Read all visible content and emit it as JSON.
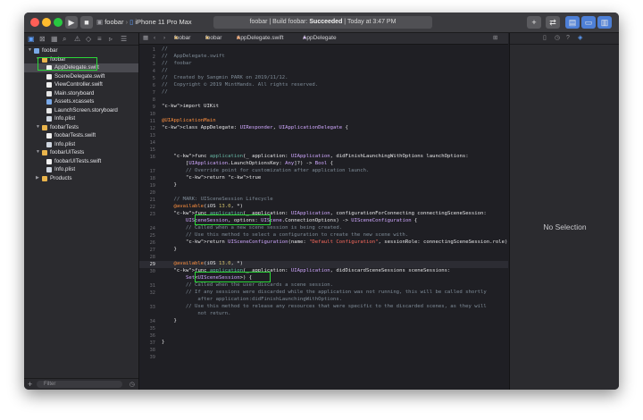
{
  "toolbar": {
    "scheme": "foobar",
    "device": "iPhone 11 Pro Max",
    "activity_prefix": "foobar | Build foobar: ",
    "activity_status": "Succeeded",
    "activity_time": " | Today at 3:47 PM",
    "plus_label": "+"
  },
  "navigator": {
    "items": [
      {
        "label": "foobar",
        "indent": 0,
        "kind": "project",
        "open": true
      },
      {
        "label": "foobar",
        "indent": 1,
        "kind": "folder",
        "open": true
      },
      {
        "label": "AppDelegate.swift",
        "indent": 2,
        "kind": "swift",
        "selected": true
      },
      {
        "label": "SceneDelegate.swift",
        "indent": 2,
        "kind": "swift"
      },
      {
        "label": "ViewController.swift",
        "indent": 2,
        "kind": "swift"
      },
      {
        "label": "Main.storyboard",
        "indent": 2,
        "kind": "storyboard"
      },
      {
        "label": "Assets.xcassets",
        "indent": 2,
        "kind": "assets"
      },
      {
        "label": "LaunchScreen.storyboard",
        "indent": 2,
        "kind": "storyboard"
      },
      {
        "label": "Info.plist",
        "indent": 2,
        "kind": "plist"
      },
      {
        "label": "foobarTests",
        "indent": 1,
        "kind": "folder",
        "open": true
      },
      {
        "label": "foobarTests.swift",
        "indent": 2,
        "kind": "swift"
      },
      {
        "label": "Info.plist",
        "indent": 2,
        "kind": "plist"
      },
      {
        "label": "foobarUITests",
        "indent": 1,
        "kind": "folder",
        "open": true
      },
      {
        "label": "foobarUITests.swift",
        "indent": 2,
        "kind": "swift"
      },
      {
        "label": "Info.plist",
        "indent": 2,
        "kind": "plist"
      },
      {
        "label": "Products",
        "indent": 1,
        "kind": "folder",
        "open": false
      }
    ],
    "filter_placeholder": "Filter"
  },
  "jumpbar": {
    "crumbs": [
      "foobar",
      "foobar",
      "AppDelegate.swift",
      "AppDelegate"
    ]
  },
  "editor": {
    "current_line": "29",
    "lines": [
      {
        "n": "1",
        "t": "//",
        "c": "com"
      },
      {
        "n": "2",
        "t": "//  AppDelegate.swift",
        "c": "com"
      },
      {
        "n": "3",
        "t": "//  foobar",
        "c": "com"
      },
      {
        "n": "4",
        "t": "//",
        "c": "com"
      },
      {
        "n": "5",
        "t": "//  Created by Sangmin PARK on 2019/11/12.",
        "c": "com"
      },
      {
        "n": "6",
        "t": "//  Copyright © 2019 MintHands. All rights reserved.",
        "c": "com"
      },
      {
        "n": "7",
        "t": "//",
        "c": "com"
      },
      {
        "n": "8",
        "t": "",
        "c": ""
      },
      {
        "n": "9",
        "t": "import UIKit",
        "c": "import"
      },
      {
        "n": "10",
        "t": "",
        "c": ""
      },
      {
        "n": "11",
        "t": "@UIApplicationMain",
        "c": "attr"
      },
      {
        "n": "12",
        "t": "class AppDelegate: UIResponder, UIApplicationDelegate {",
        "c": "class"
      },
      {
        "n": "13",
        "t": "",
        "c": ""
      },
      {
        "n": "14",
        "t": "",
        "c": ""
      },
      {
        "n": "15",
        "t": "",
        "c": ""
      },
      {
        "n": "16",
        "t": "    func application(_ application: UIApplication, didFinishLaunchingWithOptions launchOptions:",
        "c": "func"
      },
      {
        "n": "",
        "t": "        [UIApplication.LaunchOptionsKey: Any]?) -> Bool {",
        "c": "plain"
      },
      {
        "n": "17",
        "t": "        // Override point for customization after application launch.",
        "c": "com"
      },
      {
        "n": "18",
        "t": "        return true",
        "c": "return"
      },
      {
        "n": "19",
        "t": "    }",
        "c": "plain"
      },
      {
        "n": "20",
        "t": "",
        "c": ""
      },
      {
        "n": "21",
        "t": "    // MARK: UISceneSession Lifecycle",
        "c": "com"
      },
      {
        "n": "22",
        "t": "    @available(iOS 13.0, *)",
        "c": "avail"
      },
      {
        "n": "23",
        "t": "    func application(_ application: UIApplication, configurationForConnecting connectingSceneSession:",
        "c": "func"
      },
      {
        "n": "",
        "t": "        UISceneSession, options: UIScene.ConnectionOptions) -> UISceneConfiguration {",
        "c": "plain"
      },
      {
        "n": "24",
        "t": "        // Called when a new scene session is being created.",
        "c": "com"
      },
      {
        "n": "25",
        "t": "        // Use this method to select a configuration to create the new scene with.",
        "c": "com"
      },
      {
        "n": "26",
        "t": "        return UISceneConfiguration(name: \"Default Configuration\", sessionRole: connectingSceneSession.role)",
        "c": "return2"
      },
      {
        "n": "27",
        "t": "    }",
        "c": "plain"
      },
      {
        "n": "28",
        "t": "",
        "c": ""
      },
      {
        "n": "29",
        "t": "    @available(iOS 13.0, *)",
        "c": "avail"
      },
      {
        "n": "30",
        "t": "    func application(_ application: UIApplication, didDiscardSceneSessions sceneSessions:",
        "c": "func"
      },
      {
        "n": "",
        "t": "        Set<UISceneSession>) {",
        "c": "plain"
      },
      {
        "n": "31",
        "t": "        // Called when the user discards a scene session.",
        "c": "com"
      },
      {
        "n": "32",
        "t": "        // If any sessions were discarded while the application was not running, this will be called shortly",
        "c": "com"
      },
      {
        "n": "",
        "t": "            after application:didFinishLaunchingWithOptions.",
        "c": "com"
      },
      {
        "n": "33",
        "t": "        // Use this method to release any resources that were specific to the discarded scenes, as they will",
        "c": "com"
      },
      {
        "n": "",
        "t": "            not return.",
        "c": "com"
      },
      {
        "n": "34",
        "t": "    }",
        "c": "plain"
      },
      {
        "n": "35",
        "t": "",
        "c": ""
      },
      {
        "n": "36",
        "t": "",
        "c": ""
      },
      {
        "n": "37",
        "t": "}",
        "c": "plain"
      },
      {
        "n": "38",
        "t": "",
        "c": ""
      },
      {
        "n": "39",
        "t": "",
        "c": ""
      }
    ]
  },
  "inspector": {
    "empty_label": "No Selection"
  },
  "colors": {
    "traffic_red": "#fe5f57",
    "traffic_yellow": "#febc2e",
    "traffic_green": "#28c840",
    "highlight_box": "#2bd838"
  }
}
